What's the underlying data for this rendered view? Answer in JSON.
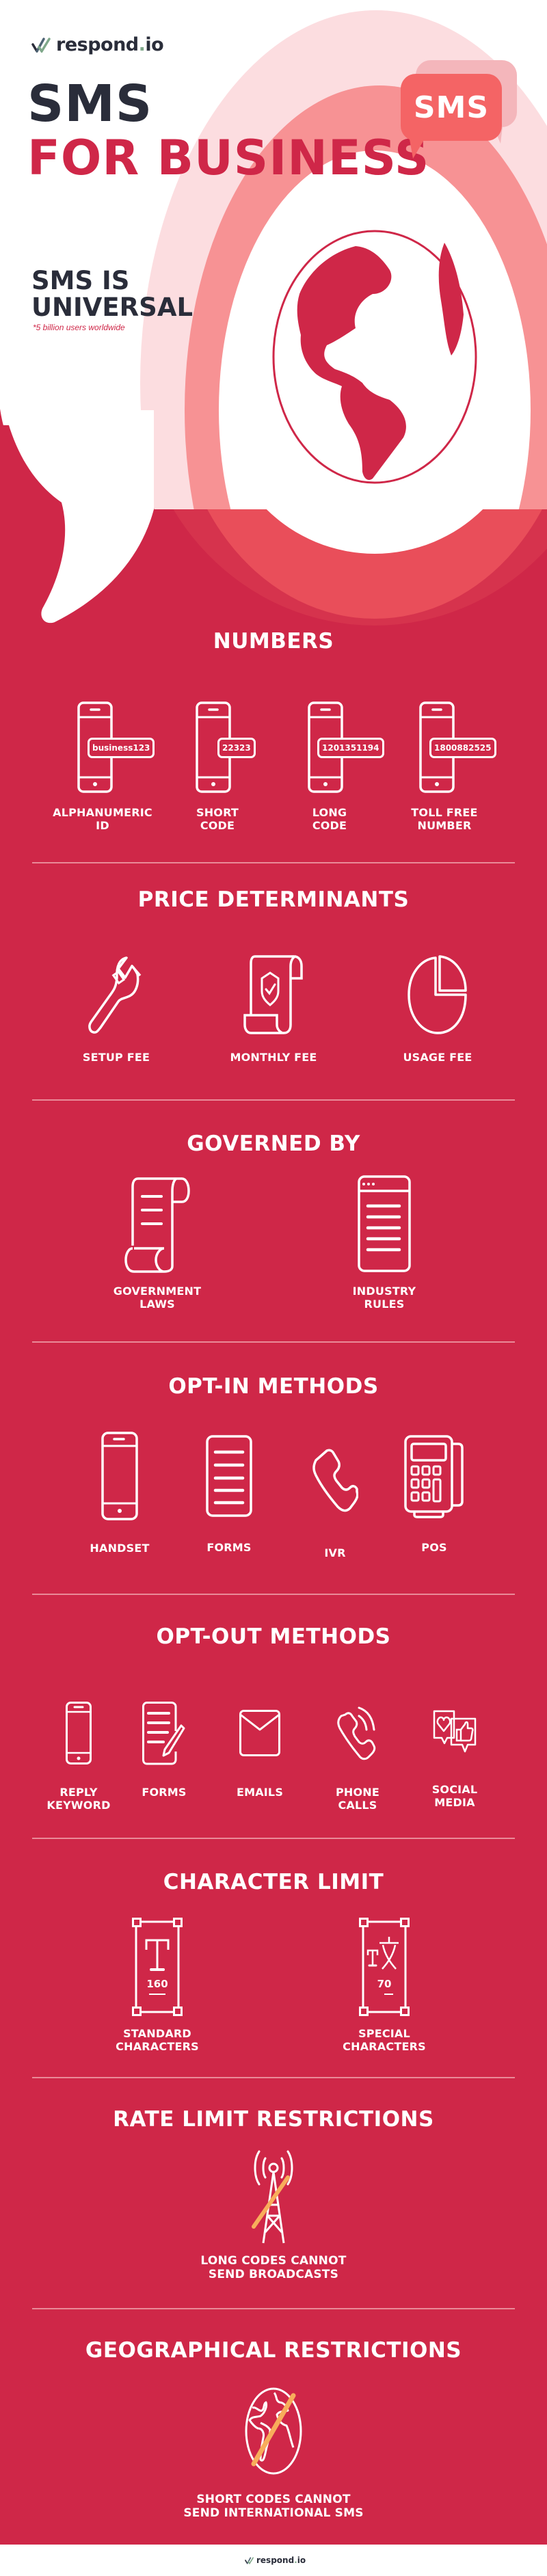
{
  "brand": {
    "logo_text": "respond",
    "logo_dot": ".",
    "logo_suffix": "io"
  },
  "header": {
    "title_line1": "SMS",
    "title_line2": "FOR BUSINESS",
    "bubble_label": "SMS"
  },
  "hero": {
    "heading_line1": "SMS IS",
    "heading_line2": "UNIVERSAL",
    "note": "*5 billion users worldwide"
  },
  "numbers": {
    "title": "NUMBERS",
    "items": [
      {
        "screen_value": "business123",
        "label": "ALPHANUMERIC\nID"
      },
      {
        "screen_value": "22323",
        "label": "SHORT\nCODE"
      },
      {
        "screen_value": "1201351194",
        "label": "LONG\nCODE"
      },
      {
        "screen_value": "1800882525",
        "label": "TOLL FREE\nNUMBER"
      }
    ]
  },
  "price": {
    "title": "PRICE DETERMINANTS",
    "items": [
      {
        "icon": "wrench-icon",
        "label": "SETUP FEE"
      },
      {
        "icon": "scroll-shield-icon",
        "label": "MONTHLY FEE"
      },
      {
        "icon": "pie-chart-icon",
        "label": "USAGE FEE"
      }
    ]
  },
  "governed": {
    "title": "GOVERNED BY",
    "items": [
      {
        "icon": "scroll-icon",
        "label": "GOVERNMENT\nLAWS"
      },
      {
        "icon": "browser-document-icon",
        "label": "INDUSTRY\nRULES"
      }
    ]
  },
  "optin": {
    "title": "OPT-IN METHODS",
    "items": [
      {
        "icon": "phone-icon",
        "label": "HANDSET"
      },
      {
        "icon": "form-icon",
        "label": "FORMS"
      },
      {
        "icon": "telephone-icon",
        "label": "IVR"
      },
      {
        "icon": "pos-terminal-icon",
        "label": "POS"
      }
    ]
  },
  "optout": {
    "title": "OPT-OUT METHODS",
    "items": [
      {
        "icon": "phone-icon",
        "label": "REPLY\nKEYWORD"
      },
      {
        "icon": "form-pencil-icon",
        "label": "FORMS"
      },
      {
        "icon": "envelope-icon",
        "label": "EMAILS"
      },
      {
        "icon": "phone-ringing-icon",
        "label": "PHONE\nCALLS"
      },
      {
        "icon": "social-media-icon",
        "label": "SOCIAL\nMEDIA"
      }
    ]
  },
  "charlimit": {
    "title": "CHARACTER LIMIT",
    "items": [
      {
        "icon": "text-frame-icon",
        "count": "160",
        "label": "STANDARD\nCHARACTERS"
      },
      {
        "icon": "translate-frame-icon",
        "count": "70",
        "label": "SPECIAL\nCHARACTERS"
      }
    ]
  },
  "ratelimit": {
    "title": "RATE LIMIT RESTRICTIONS",
    "caption": "LONG CODES CANNOT\nSEND BROADCASTS"
  },
  "geo": {
    "title": "GEOGRAPHICAL RESTRICTIONS",
    "caption": "SHORT CODES CANNOT\nSEND INTERNATIONAL SMS"
  },
  "colors": {
    "brand_red": "#CF2748",
    "dark": "#2A2D3A",
    "coral": "#F46465",
    "pink_light": "#FCDDE0",
    "strike_orange": "#F8AD5B"
  }
}
